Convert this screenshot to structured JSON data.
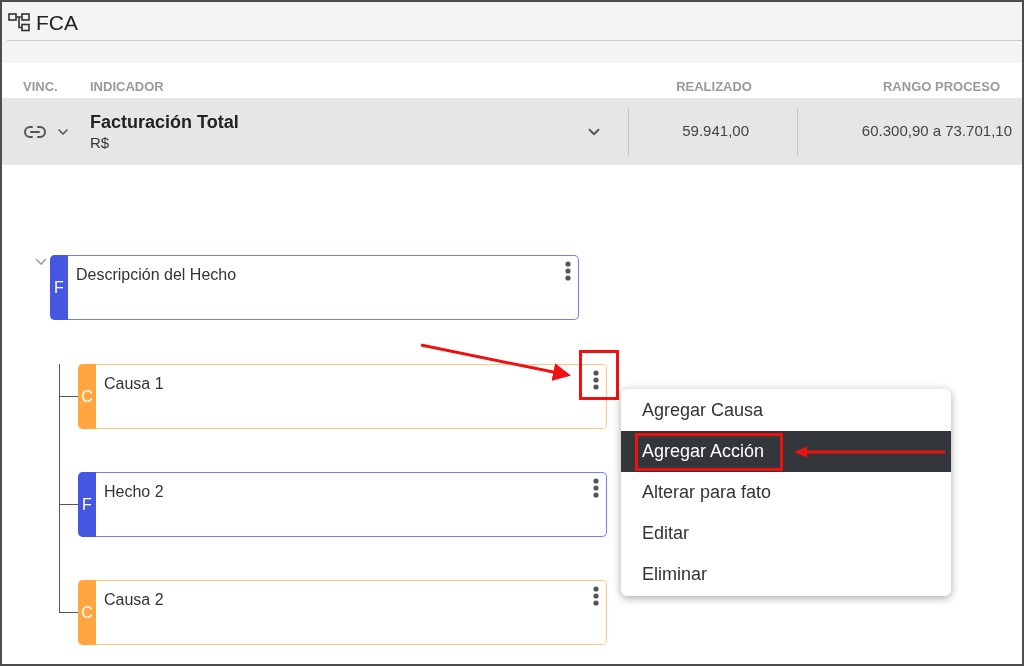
{
  "header": {
    "title": "FCA"
  },
  "table": {
    "columns": [
      "VINC.",
      "INDICADOR",
      "REALIZADO",
      "RANGO PROCESO"
    ],
    "rows": [
      {
        "indicator": "Facturación Total",
        "unit": "R$",
        "realizado": "59.941,00",
        "rango_proceso": "60.300,90 a 73.701,10"
      }
    ]
  },
  "tree": {
    "root": {
      "kind": "fact",
      "badge": "F",
      "text": "Descripción del Hecho",
      "expanded": true,
      "highlighted": false,
      "children": [
        {
          "kind": "cause",
          "badge": "C",
          "text": "Causa 1",
          "highlighted": true
        },
        {
          "kind": "fact",
          "badge": "F",
          "text": "Hecho 2",
          "highlighted": false
        },
        {
          "kind": "cause",
          "badge": "C",
          "text": "Causa 2",
          "highlighted": false
        }
      ]
    }
  },
  "context_menu": {
    "items": [
      {
        "label": "Agregar Causa",
        "selected": false,
        "highlighted": false
      },
      {
        "label": "Agregar Acción",
        "selected": true,
        "highlighted": true
      },
      {
        "label": "Alterar para fato",
        "selected": false,
        "highlighted": false
      },
      {
        "label": "Editar",
        "selected": false,
        "highlighted": false
      },
      {
        "label": "Eliminar",
        "selected": false,
        "highlighted": false
      }
    ]
  }
}
